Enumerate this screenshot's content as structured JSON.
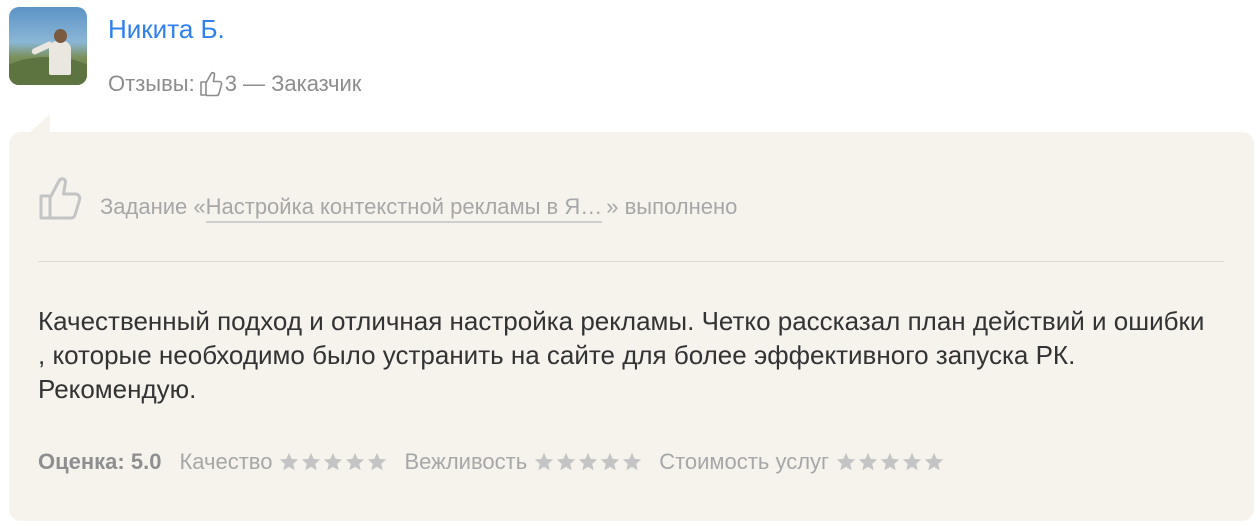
{
  "author": {
    "name": "Никита Б.",
    "reviews_label": "Отзывы:",
    "reviews_count": "3",
    "role": "— Заказчик"
  },
  "task": {
    "prefix": "Задание «",
    "title": "Настройка контекстной рекламы в Я…",
    "suffix": "» выполнено"
  },
  "review": {
    "text": "Качественный подход и отличная настройка рекламы. Четко рассказал план действий и ошибки , которые необходимо было устранить на сайте для более эффективного запуска РК. Рекомендую."
  },
  "ratings": {
    "score_label": "Оценка: 5.0",
    "criteria": [
      {
        "label": "Качество",
        "stars": 5
      },
      {
        "label": "Вежливость",
        "stars": 5
      },
      {
        "label": "Стоимость услуг",
        "stars": 5
      }
    ]
  },
  "colors": {
    "link": "#2f80ed",
    "card_bg": "#f5f3ec",
    "muted": "#a7a7a7",
    "star": "#c4c4c4"
  }
}
